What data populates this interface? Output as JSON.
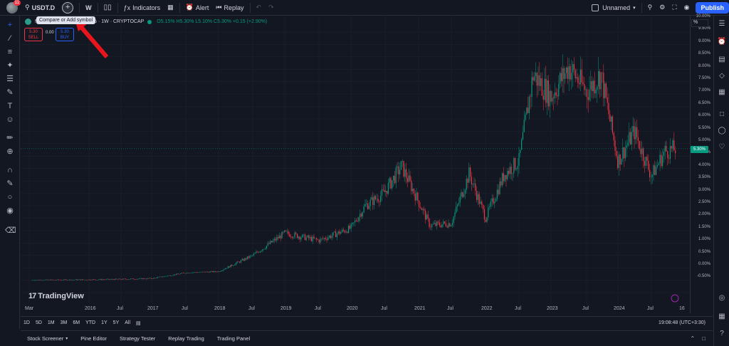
{
  "topbar": {
    "avatar_badge": "11",
    "symbol": "USDT.D",
    "interval": "W",
    "indicators": "Indicators",
    "alert": "Alert",
    "replay": "Replay",
    "layout_name": "Unnamed",
    "publish": "Publish"
  },
  "tooltip": "Compare or Add symbol",
  "legend": {
    "title_prefix": "M",
    "title_suffix": "nance, % · 1W · CRYPTOCAP",
    "ohlc": "O5.15% H5.30% L5.10% C5.30% +0.15 (+2.90%)"
  },
  "trade": {
    "sell_price": "5.30",
    "sell_label": "SELL",
    "spread": "0.00",
    "buy_price": "5.30",
    "buy_label": "BUY"
  },
  "price_axis": {
    "scale_button": "%",
    "current_price": "5.30%",
    "labels": [
      "10.00%",
      "9.50%",
      "9.00%",
      "8.50%",
      "8.00%",
      "7.50%",
      "7.00%",
      "6.50%",
      "6.00%",
      "5.50%",
      "5.00%",
      "4.50%",
      "4.00%",
      "3.50%",
      "3.00%",
      "2.50%",
      "2.00%",
      "1.50%",
      "1.00%",
      "0.50%",
      "0.00%",
      "-0.50%"
    ]
  },
  "time_axis": {
    "labels": [
      "Mar",
      "2016",
      "Jul",
      "2017",
      "Jul",
      "2018",
      "Jul",
      "2019",
      "Jul",
      "2020",
      "Jul",
      "2021",
      "Jul",
      "2022",
      "Jul",
      "2023",
      "Jul",
      "2024",
      "Jul",
      "16"
    ]
  },
  "range_bar": {
    "ranges": [
      "1D",
      "5D",
      "1M",
      "3M",
      "6M",
      "YTD",
      "1Y",
      "5Y",
      "All"
    ],
    "clock": "19:08:48 (UTC+3:30)"
  },
  "bottom_panel": {
    "tabs": [
      "Stock Screener",
      "Pine Editor",
      "Strategy Tester",
      "Replay Trading",
      "Trading Panel"
    ]
  },
  "watermark": "TradingView",
  "colors": {
    "background": "#131722",
    "up": "#089981",
    "down": "#f23645",
    "accent": "#2962ff"
  },
  "chart_data": {
    "type": "candlestick",
    "title": "",
    "ylabel": "%",
    "ylim": [
      -0.5,
      10.0
    ],
    "x": [
      "2015-03",
      "2016-01",
      "2016-07",
      "2017-01",
      "2017-07",
      "2018-01",
      "2018-07",
      "2019-01",
      "2019-07",
      "2020-01",
      "2020-07",
      "2021-01",
      "2021-07",
      "2022-01",
      "2022-07",
      "2023-01",
      "2023-07",
      "2024-01",
      "2024-07",
      "2024-10"
    ],
    "series": [
      {
        "values": [
          0.03,
          0.04,
          0.05,
          0.08,
          0.25,
          0.4,
          0.9,
          1.8,
          1.5,
          1.9,
          3.5,
          2.2,
          2.6,
          4.0,
          8.5,
          7.8,
          8.2,
          4.2,
          5.8,
          5.3
        ]
      }
    ]
  }
}
